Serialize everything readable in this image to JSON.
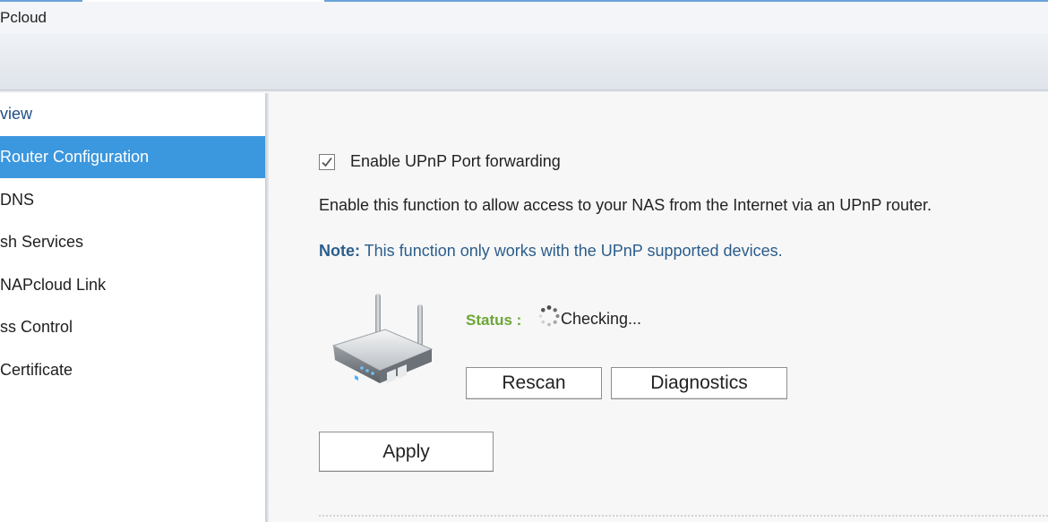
{
  "window": {
    "title": "Pcloud"
  },
  "sidebar": {
    "items": [
      {
        "label": "view",
        "active": false
      },
      {
        "label": "Router Configuration",
        "active": true
      },
      {
        "label": "DNS",
        "active": false
      },
      {
        "label": "sh Services",
        "active": false
      },
      {
        "label": "NAPcloud Link",
        "active": false
      },
      {
        "label": "ss Control",
        "active": false
      },
      {
        "label": "Certificate",
        "active": false
      }
    ]
  },
  "main": {
    "enable_upnp": {
      "label": "Enable UPnP Port forwarding",
      "checked": true
    },
    "description": "Enable this function to allow access to your NAS from the Internet via an UPnP router.",
    "note": {
      "prefix": "Note:",
      "text": " This function only works with the UPnP supported devices."
    },
    "status": {
      "label": "Status :",
      "value": "Checking..."
    },
    "buttons": {
      "rescan": "Rescan",
      "diagnostics": "Diagnostics",
      "apply": "Apply"
    }
  },
  "colors": {
    "accent": "#3b97de",
    "note_text": "#2b5d8c",
    "status_label": "#6ba637"
  },
  "icons": {
    "router": "router-icon",
    "spinner": "loading-spinner-icon",
    "checkbox": "checkmark-icon"
  }
}
